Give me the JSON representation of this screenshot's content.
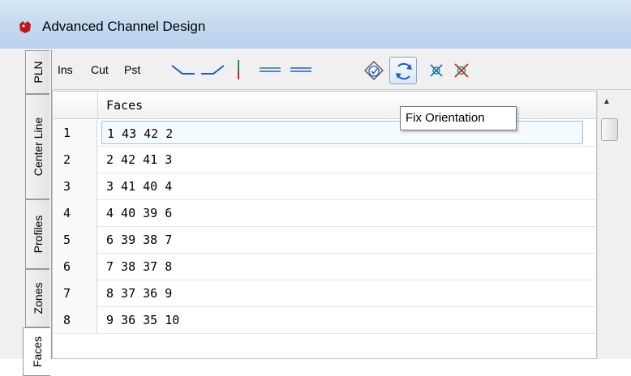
{
  "window": {
    "title": "Advanced Channel Design"
  },
  "tabs": [
    {
      "label": "PLN"
    },
    {
      "label": "Center Line"
    },
    {
      "label": "Profiles"
    },
    {
      "label": "Zones"
    },
    {
      "label": "Faces"
    }
  ],
  "toolbar": {
    "ins_label": "Ins",
    "cut_label": "Cut",
    "pst_label": "Pst",
    "icons": [
      "slope-down-line-icon",
      "slope-up-line-icon",
      "vertical-bar-icon",
      "flat-line-left-icon",
      "flat-line-right-icon",
      "validate-icon",
      "fix-orientation-icon",
      "delete-node-icon",
      "delete-all-nodes-icon"
    ]
  },
  "grid": {
    "column_header": "Faces",
    "rows": [
      {
        "num": "1",
        "faces": "1 43 42 2"
      },
      {
        "num": "2",
        "faces": "2 42 41 3"
      },
      {
        "num": "3",
        "faces": "3 41 40 4"
      },
      {
        "num": "4",
        "faces": "4 40 39 6"
      },
      {
        "num": "5",
        "faces": "6 39 38 7"
      },
      {
        "num": "6",
        "faces": "7 38 37 8"
      },
      {
        "num": "7",
        "faces": "8 37 36 9"
      },
      {
        "num": "8",
        "faces": "9 36 35 10"
      }
    ]
  },
  "tooltip": {
    "text": "Fix Orientation"
  },
  "colors": {
    "accent_blue": "#1f5fc6",
    "line_green": "#1e8c6a",
    "delete_red": "#d0202a"
  }
}
